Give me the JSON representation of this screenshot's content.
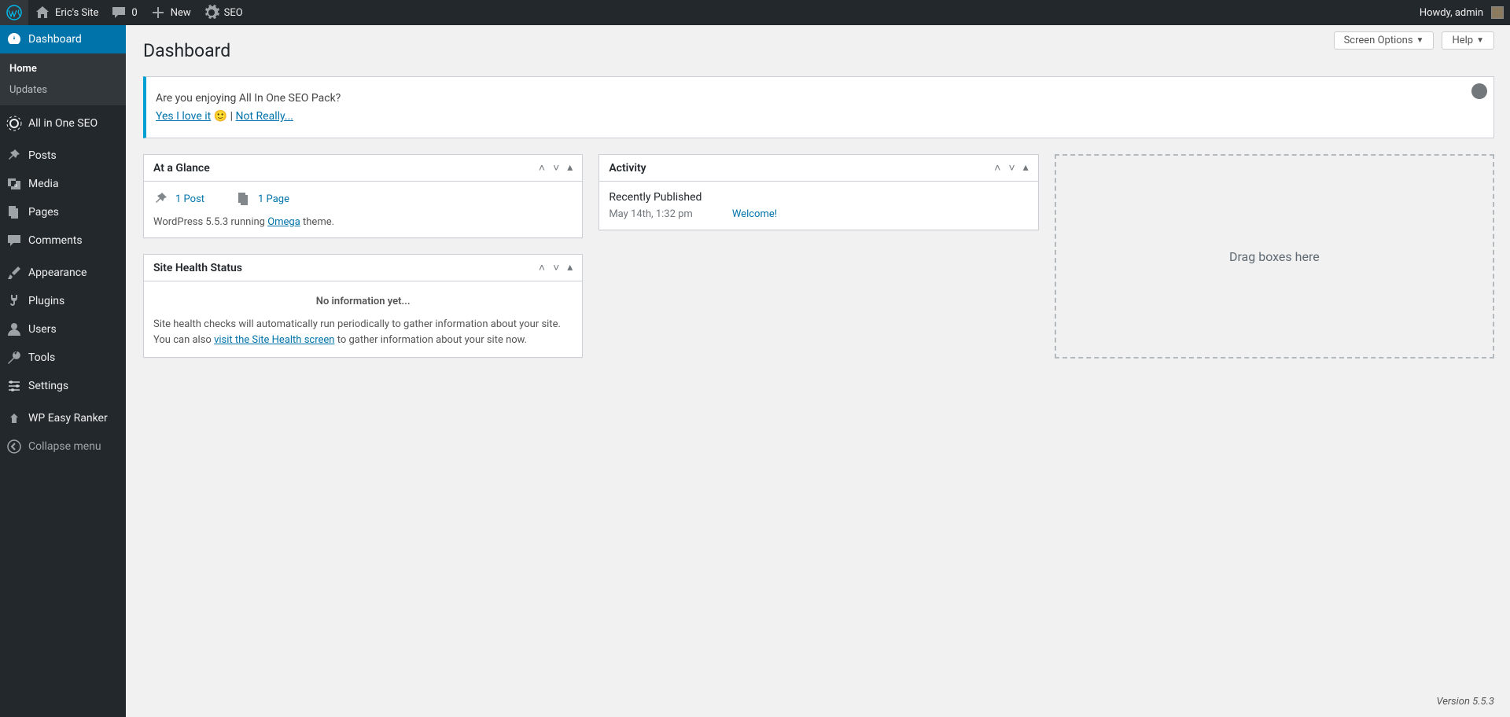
{
  "adminbar": {
    "site_name": "Eric's Site",
    "comments_count": "0",
    "new_label": "New",
    "seo_label": "SEO",
    "howdy": "Howdy, admin"
  },
  "sidebar": {
    "dashboard": "Dashboard",
    "submenu": {
      "home": "Home",
      "updates": "Updates"
    },
    "aioseo": "All in One SEO",
    "posts": "Posts",
    "media": "Media",
    "pages": "Pages",
    "comments": "Comments",
    "appearance": "Appearance",
    "plugins": "Plugins",
    "users": "Users",
    "tools": "Tools",
    "settings": "Settings",
    "wpranker": "WP Easy Ranker",
    "collapse": "Collapse menu"
  },
  "buttons": {
    "screen_options": "Screen Options",
    "help": "Help"
  },
  "page_title": "Dashboard",
  "notice": {
    "question": "Are you enjoying All In One SEO Pack?",
    "yes": "Yes I love it",
    "emoji": "🙂",
    "sep": " | ",
    "no": "Not Really..."
  },
  "glance": {
    "title": "At a Glance",
    "post": "1 Post",
    "page": "1 Page",
    "version_pre": "WordPress 5.5.3 running ",
    "theme": "Omega",
    "version_post": " theme."
  },
  "activity": {
    "title": "Activity",
    "recent": "Recently Published",
    "date": "May 14th, 1:32 pm",
    "link": "Welcome!"
  },
  "health": {
    "title": "Site Health Status",
    "noinfo": "No information yet...",
    "text1": "Site health checks will automatically run periodically to gather information about your site. You can also ",
    "link": "visit the Site Health screen",
    "text2": " to gather information about your site now."
  },
  "dropzone": "Drag boxes here",
  "footer_version": "Version 5.5.3"
}
